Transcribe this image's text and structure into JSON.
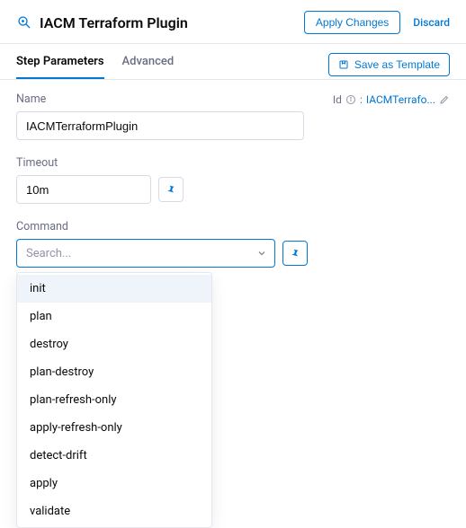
{
  "header": {
    "title": "IACM Terraform Plugin",
    "apply_label": "Apply Changes",
    "discard_label": "Discard"
  },
  "tabs": {
    "step_parameters": "Step Parameters",
    "advanced": "Advanced"
  },
  "template_btn": "Save as Template",
  "fields": {
    "name_label": "Name",
    "id_label": "Id",
    "id_sep": ":",
    "id_value": "IACMTerrafo...",
    "name_value": "IACMTerraformPlugin",
    "timeout_label": "Timeout",
    "timeout_value": "10m",
    "command_label": "Command",
    "command_placeholder": "Search..."
  },
  "dropdown": {
    "items": [
      "init",
      "plan",
      "destroy",
      "plan-destroy",
      "plan-refresh-only",
      "apply-refresh-only",
      "detect-drift",
      "apply",
      "validate"
    ]
  },
  "icons": {
    "plugin": "plugin-icon",
    "template": "template-icon",
    "info": "info-icon",
    "pencil": "pencil-icon",
    "pin": "thumbtack-icon",
    "chevron": "chevron-down-icon"
  }
}
